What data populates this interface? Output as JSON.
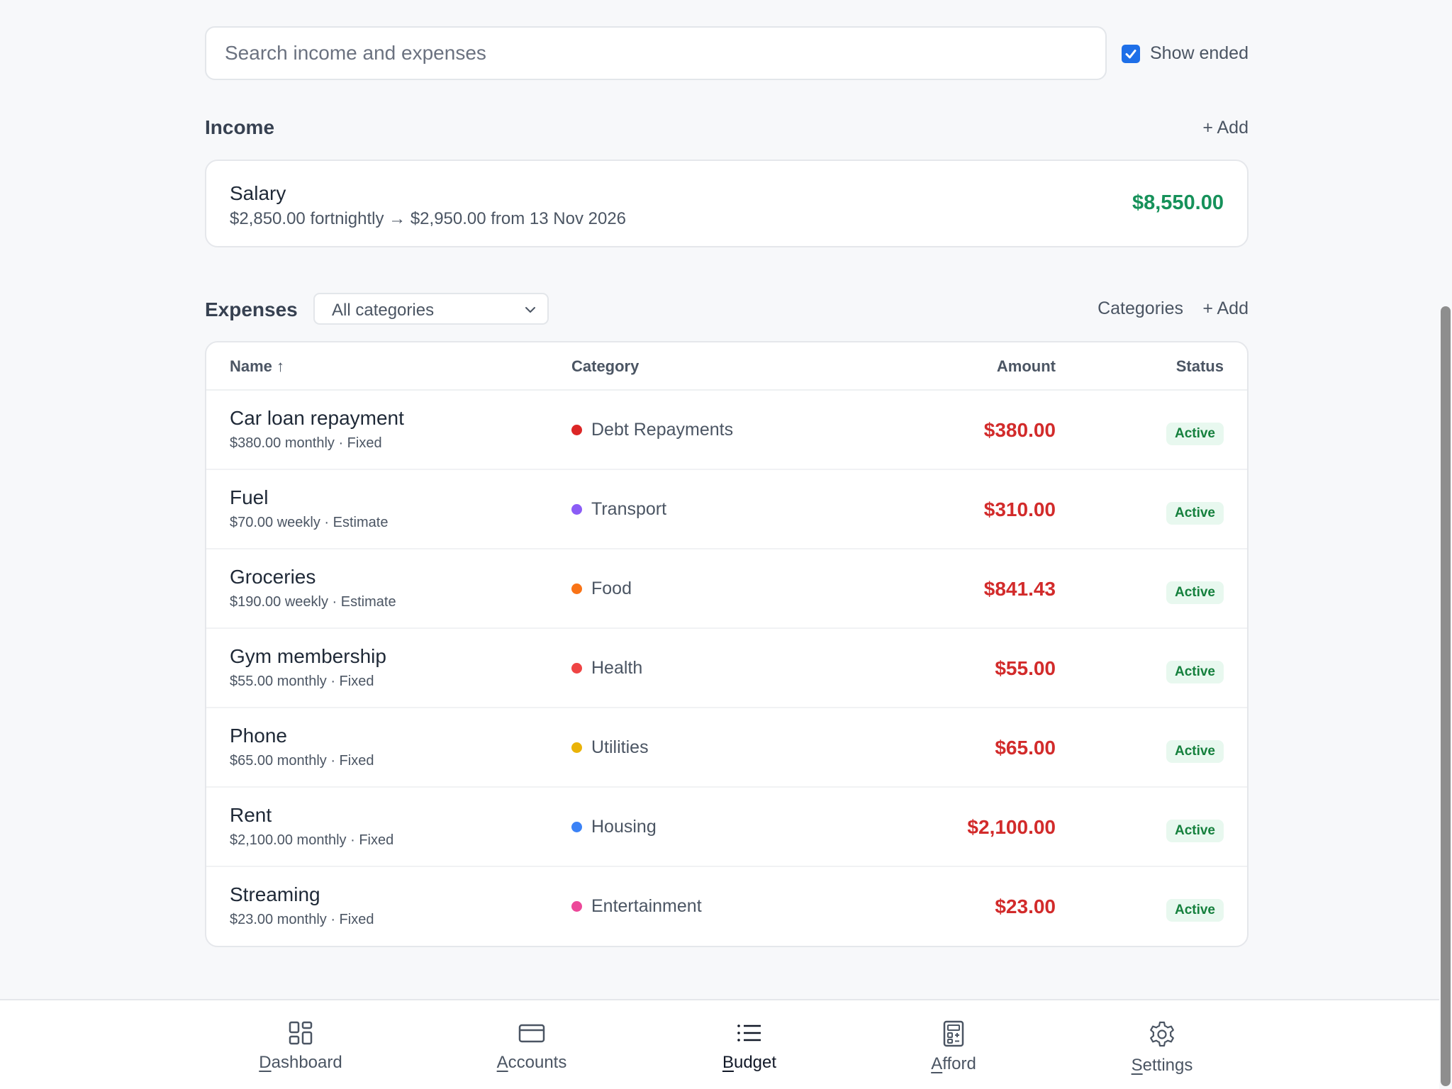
{
  "search": {
    "placeholder": "Search income and expenses"
  },
  "show_ended": {
    "label": "Show ended",
    "checked": true
  },
  "income": {
    "title": "Income",
    "add_label": "+ Add",
    "items": [
      {
        "name": "Salary",
        "detail": "$2,850.00 fortnightly → $2,950.00 from 13 Nov 2026",
        "amount": "$8,550.00"
      }
    ]
  },
  "expenses": {
    "title": "Expenses",
    "filter_value": "All categories",
    "categories_label": "Categories",
    "add_label": "+ Add",
    "columns": {
      "name": "Name ↑",
      "category": "Category",
      "amount": "Amount",
      "status": "Status"
    },
    "rows": [
      {
        "name": "Car loan repayment",
        "detail": "$380.00 monthly · Fixed",
        "category": "Debt Repayments",
        "color": "#dc2626",
        "amount": "$380.00",
        "status": "Active"
      },
      {
        "name": "Fuel",
        "detail": "$70.00 weekly · Estimate",
        "category": "Transport",
        "color": "#8b5cf6",
        "amount": "$310.00",
        "status": "Active"
      },
      {
        "name": "Groceries",
        "detail": "$190.00 weekly · Estimate",
        "category": "Food",
        "color": "#f97316",
        "amount": "$841.43",
        "status": "Active"
      },
      {
        "name": "Gym membership",
        "detail": "$55.00 monthly · Fixed",
        "category": "Health",
        "color": "#ef4444",
        "amount": "$55.00",
        "status": "Active"
      },
      {
        "name": "Phone",
        "detail": "$65.00 monthly · Fixed",
        "category": "Utilities",
        "color": "#eab308",
        "amount": "$65.00",
        "status": "Active"
      },
      {
        "name": "Rent",
        "detail": "$2,100.00 monthly · Fixed",
        "category": "Housing",
        "color": "#3b82f6",
        "amount": "$2,100.00",
        "status": "Active"
      },
      {
        "name": "Streaming",
        "detail": "$23.00 monthly · Fixed",
        "category": "Entertainment",
        "color": "#ec4899",
        "amount": "$23.00",
        "status": "Active"
      }
    ]
  },
  "nav": {
    "items": [
      {
        "first": "D",
        "rest": "ashboard",
        "icon": "dashboard-icon"
      },
      {
        "first": "A",
        "rest": "ccounts",
        "icon": "credit-card-icon"
      },
      {
        "first": "B",
        "rest": "udget",
        "icon": "list-icon"
      },
      {
        "first": "A",
        "rest": "fford",
        "icon": "calculator-icon"
      },
      {
        "first": "S",
        "rest": "ettings",
        "icon": "gear-icon"
      }
    ],
    "active_index": 2
  },
  "colors": {
    "accent": "#1e6fe8",
    "income": "#16915a",
    "expense": "#d22b2b",
    "active_badge_bg": "#e8f8ef",
    "active_badge_text": "#15803d"
  }
}
